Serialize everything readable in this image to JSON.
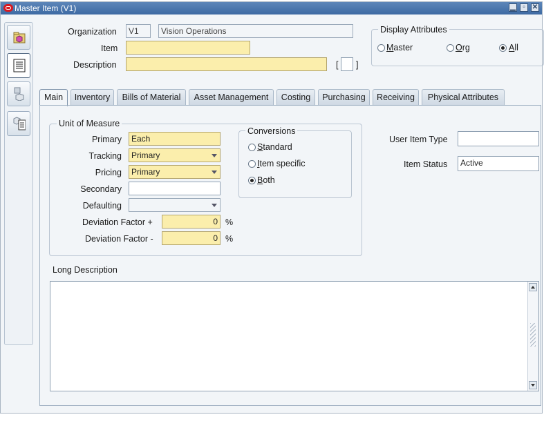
{
  "window": {
    "title": "Master Item (V1)"
  },
  "header": {
    "organization_label": "Organization",
    "organization_code": "V1",
    "organization_name": "Vision Operations",
    "item_label": "Item",
    "item_value": "",
    "description_label": "Description",
    "description_value": "",
    "bracket_open": "[",
    "bracket_close": "]"
  },
  "display_attributes": {
    "label": "Display Attributes",
    "options": [
      {
        "label": "Master",
        "mnemonic": "M",
        "rest": "aster",
        "selected": false
      },
      {
        "label": "Org",
        "mnemonic": "O",
        "rest": "rg",
        "selected": false
      },
      {
        "label": "All",
        "mnemonic": "A",
        "rest": "ll",
        "selected": true
      }
    ]
  },
  "tabs": [
    {
      "label": "Main",
      "active": true
    },
    {
      "label": "Inventory",
      "active": false
    },
    {
      "label": "Bills of Material",
      "active": false
    },
    {
      "label": "Asset Management",
      "active": false
    },
    {
      "label": "Costing",
      "active": false
    },
    {
      "label": "Purchasing",
      "active": false
    },
    {
      "label": "Receiving",
      "active": false
    },
    {
      "label": "Physical Attributes",
      "active": false
    }
  ],
  "unit_of_measure": {
    "label": "Unit of Measure",
    "primary_label": "Primary",
    "primary_value": "Each",
    "tracking_label": "Tracking",
    "tracking_value": "Primary",
    "pricing_label": "Pricing",
    "pricing_value": "Primary",
    "secondary_label": "Secondary",
    "secondary_value": "",
    "defaulting_label": "Defaulting",
    "defaulting_value": "",
    "dev_plus_label": "Deviation Factor +",
    "dev_plus_value": "0",
    "dev_minus_label": "Deviation Factor -",
    "dev_minus_value": "0",
    "percent": "%"
  },
  "conversions": {
    "label": "Conversions",
    "options": [
      {
        "label": "Standard",
        "mnemonic": "S",
        "rest": "tandard",
        "selected": false
      },
      {
        "label": "Item specific",
        "mnemonic": "I",
        "rest": "tem specific",
        "selected": false
      },
      {
        "label": "Both",
        "mnemonic": "B",
        "rest": "oth",
        "selected": true
      }
    ]
  },
  "right_fields": {
    "user_item_type_label": "User Item Type",
    "user_item_type_value": "",
    "item_status_label": "Item Status",
    "item_status_value": "Active"
  },
  "long_description": {
    "label": "Long Description",
    "value": ""
  },
  "colors": {
    "required": "#fbeeac",
    "titlebar": "#4a76ad",
    "logo": "#d71920"
  },
  "icons": [
    "oracle-logo-icon",
    "minimize-icon",
    "maximize-icon",
    "close-icon",
    "folder-icon",
    "item-list-icon",
    "item-attributes-icon",
    "item-catalog-icon"
  ]
}
